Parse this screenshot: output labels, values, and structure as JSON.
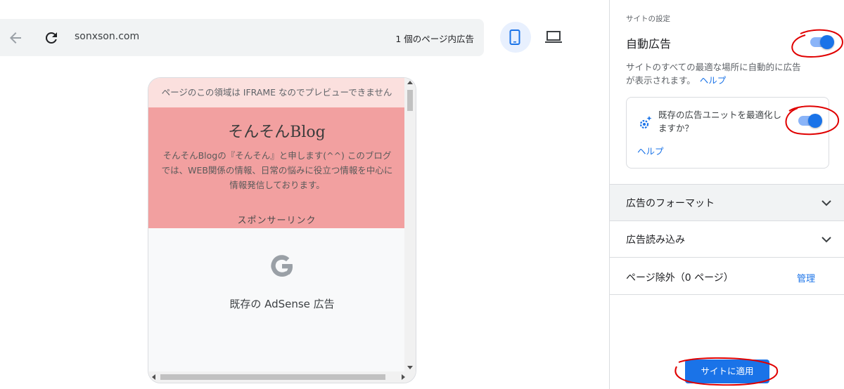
{
  "toolbar": {
    "url": "sonxson.com",
    "ad_count": "1 個のページ内広告"
  },
  "preview": {
    "iframe_notice": "ページのこの領域は IFRAME なのでプレビューできません",
    "blog_title": "そんそんBlog",
    "blog_description": "そんそんBlogの『そんそん』と申します(^^) このブログでは、WEB関係の情報、日常の悩みに役立つ情報を中心に情報発信しております。",
    "sponsor_label": "スポンサーリンク",
    "ad_label": "既存の AdSense 広告"
  },
  "panel": {
    "section_label": "サイトの設定",
    "auto_ads_title": "自動広告",
    "auto_ads_enabled": true,
    "auto_ads_description": "サイトのすべての最適な場所に自動的に広告が表示されます。",
    "help_link": "ヘルプ",
    "optimize_question": "既存の広告ユニットを最適化しますか？",
    "optimize_enabled": true,
    "optimize_help": "ヘルプ",
    "ad_formats_label": "広告のフォーマット",
    "ad_load_label": "広告読み込み",
    "page_exclusion_label": "ページ除外（0 ページ）",
    "manage_link": "管理",
    "apply_button": "サイトに適用"
  },
  "colors": {
    "accent": "#1a73e8",
    "blog_background": "#f2a0a0",
    "annotation": "#e00000"
  }
}
